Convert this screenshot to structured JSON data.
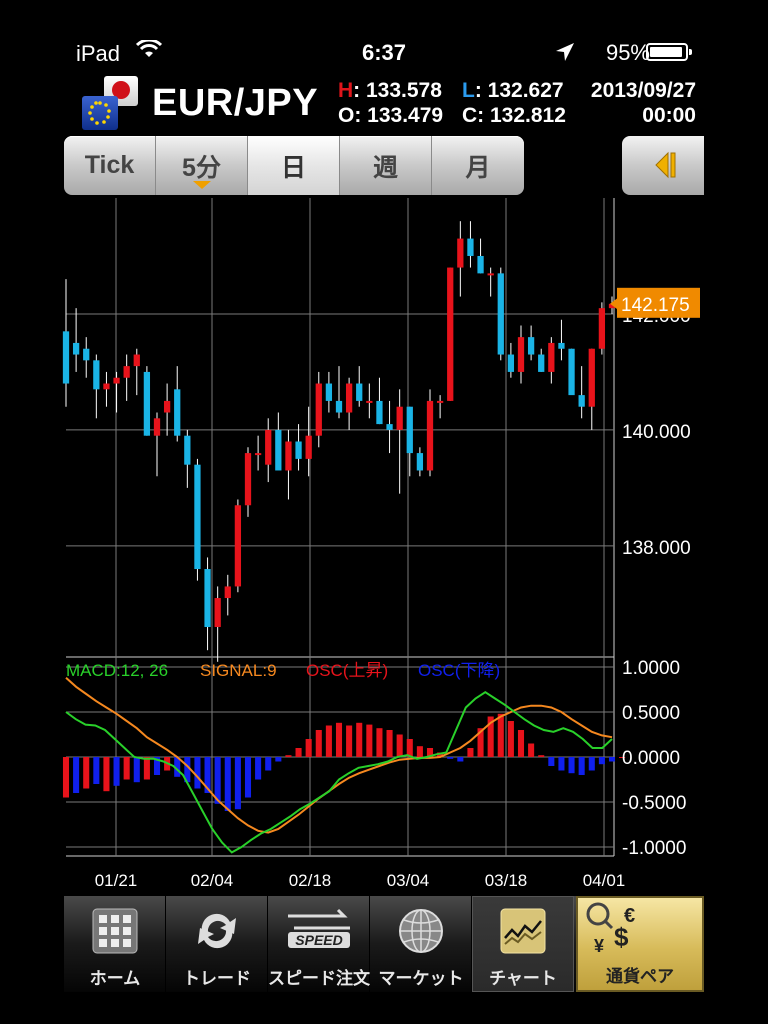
{
  "status_bar": {
    "carrier": "iPad",
    "time": "6:37",
    "battery": "95%"
  },
  "header": {
    "pair": "EUR/JPY",
    "quote": {
      "h_key": "H",
      "h": ": 133.578",
      "l_key": "L",
      "l": ": 132.627",
      "o_key": "O",
      "o": ": 133.479",
      "c_key": "C",
      "c": ": 132.812",
      "date": "2013/09/27",
      "time": "00:00"
    },
    "colors": {
      "high": "#e0151b",
      "low": "#2b9bef"
    }
  },
  "timeframes": [
    {
      "label": "Tick",
      "active": false
    },
    {
      "label": "5分",
      "active": false,
      "dropdown": true
    },
    {
      "label": "日",
      "active": true
    },
    {
      "label": "週",
      "active": false
    },
    {
      "label": "月",
      "active": false
    }
  ],
  "side_button_icon": "collapse-arrow-icon",
  "chart_data": {
    "type": "candlestick",
    "price_axis": {
      "ticks": [
        138,
        140,
        142
      ],
      "tick_labels": [
        "138.000",
        "140.000",
        "142.000"
      ],
      "range": [
        136.1,
        144.0
      ]
    },
    "current_price": "142.175",
    "current_price_value": 142.175,
    "date_labels": [
      "01/21",
      "02/04",
      "02/18",
      "03/04",
      "03/18",
      "04/01"
    ],
    "colors": {
      "up": "#e8131b",
      "down": "#1ab4e6",
      "macd": "#29d02a",
      "signal": "#f5881f",
      "osc_up": "#e8131b",
      "osc_down": "#1020ee",
      "price_tag": "#f08a00"
    },
    "candles": [
      [
        141.7,
        142.6,
        140.4,
        140.8
      ],
      [
        141.5,
        142.1,
        141.0,
        141.3
      ],
      [
        141.4,
        141.6,
        140.9,
        141.2
      ],
      [
        141.2,
        141.3,
        140.2,
        140.7
      ],
      [
        140.7,
        141.0,
        140.4,
        140.8
      ],
      [
        140.8,
        141.0,
        140.3,
        140.9
      ],
      [
        140.9,
        141.3,
        140.5,
        141.1
      ],
      [
        141.1,
        141.4,
        140.6,
        141.3
      ],
      [
        141.0,
        141.1,
        139.9,
        139.9
      ],
      [
        139.9,
        140.3,
        139.2,
        140.2
      ],
      [
        140.3,
        140.8,
        139.9,
        140.5
      ],
      [
        140.7,
        141.1,
        139.8,
        139.9
      ],
      [
        139.9,
        140.0,
        139.0,
        139.4
      ],
      [
        139.4,
        139.5,
        137.4,
        137.6
      ],
      [
        137.6,
        137.8,
        136.2,
        136.6
      ],
      [
        136.6,
        137.3,
        136.0,
        137.1
      ],
      [
        137.1,
        137.5,
        136.8,
        137.3
      ],
      [
        137.3,
        138.8,
        137.2,
        138.7
      ],
      [
        138.7,
        139.7,
        138.5,
        139.6
      ],
      [
        139.6,
        139.9,
        139.3,
        139.6
      ],
      [
        139.4,
        140.2,
        139.1,
        140.0
      ],
      [
        140.0,
        140.3,
        139.4,
        139.3
      ],
      [
        139.3,
        140.0,
        138.8,
        139.8
      ],
      [
        139.8,
        140.1,
        139.3,
        139.5
      ],
      [
        139.5,
        140.4,
        139.2,
        139.9
      ],
      [
        139.9,
        141.0,
        139.7,
        140.8
      ],
      [
        140.8,
        141.0,
        140.3,
        140.5
      ],
      [
        140.5,
        141.1,
        140.2,
        140.3
      ],
      [
        140.3,
        140.9,
        140.0,
        140.8
      ],
      [
        140.8,
        141.1,
        140.4,
        140.5
      ],
      [
        140.5,
        140.8,
        140.2,
        140.5
      ],
      [
        140.5,
        140.9,
        140.1,
        140.1
      ],
      [
        140.1,
        140.5,
        139.6,
        140.0
      ],
      [
        140.0,
        140.7,
        138.9,
        140.4
      ],
      [
        140.4,
        140.4,
        139.2,
        139.6
      ],
      [
        139.6,
        139.7,
        139.2,
        139.3
      ],
      [
        139.3,
        140.7,
        139.2,
        140.5
      ],
      [
        140.5,
        140.6,
        140.2,
        140.5
      ],
      [
        140.5,
        142.8,
        140.5,
        142.8
      ],
      [
        142.8,
        143.6,
        142.3,
        143.3
      ],
      [
        143.3,
        143.6,
        142.8,
        143.0
      ],
      [
        143.0,
        143.3,
        142.7,
        142.7
      ],
      [
        142.7,
        142.8,
        142.3,
        142.7
      ],
      [
        142.7,
        142.8,
        141.2,
        141.3
      ],
      [
        141.3,
        141.5,
        140.9,
        141.0
      ],
      [
        141.0,
        141.8,
        140.8,
        141.6
      ],
      [
        141.6,
        141.8,
        141.2,
        141.3
      ],
      [
        141.3,
        141.4,
        141.0,
        141.0
      ],
      [
        141.0,
        141.6,
        140.8,
        141.5
      ],
      [
        141.5,
        141.9,
        141.2,
        141.4
      ],
      [
        141.4,
        141.4,
        140.9,
        140.6
      ],
      [
        140.6,
        141.1,
        140.2,
        140.4
      ],
      [
        140.4,
        141.4,
        140.0,
        141.4
      ],
      [
        141.4,
        142.2,
        141.3,
        142.1
      ],
      [
        142.1,
        142.3,
        142.0,
        142.175
      ]
    ],
    "macd_panel": {
      "legend": [
        {
          "label": "MACD:12, 26",
          "color": "#29d02a"
        },
        {
          "label": "SIGNAL:9",
          "color": "#f5881f"
        },
        {
          "label": "OSC(上昇)",
          "color": "#e8131b"
        },
        {
          "label": "OSC(下降)",
          "color": "#1020ee"
        }
      ],
      "ticks": [
        1.0,
        0.5,
        0.0,
        -0.5,
        -1.0
      ],
      "tick_labels": [
        "1.0000",
        "0.5000",
        "0.0000",
        "-0.5000",
        "-1.0000"
      ],
      "range": [
        -1.1,
        1.1
      ],
      "macd": [
        0.5,
        0.42,
        0.36,
        0.35,
        0.3,
        0.2,
        0.1,
        0.0,
        -0.02,
        -0.02,
        -0.05,
        -0.1,
        -0.2,
        -0.4,
        -0.6,
        -0.8,
        -0.95,
        -1.06,
        -1.0,
        -0.92,
        -0.85,
        -0.8,
        -0.73,
        -0.66,
        -0.58,
        -0.52,
        -0.45,
        -0.38,
        -0.25,
        -0.18,
        -0.12,
        -0.1,
        -0.08,
        -0.05,
        0.0,
        0.02,
        -0.02,
        0.0,
        0.03,
        0.05,
        0.3,
        0.55,
        0.65,
        0.72,
        0.65,
        0.58,
        0.5,
        0.42,
        0.35,
        0.3,
        0.28,
        0.32,
        0.28,
        0.2,
        0.1,
        0.1,
        0.2
      ],
      "signal": [
        0.88,
        0.78,
        0.7,
        0.62,
        0.55,
        0.48,
        0.4,
        0.32,
        0.22,
        0.15,
        0.08,
        0.0,
        -0.1,
        -0.22,
        -0.35,
        -0.48,
        -0.58,
        -0.68,
        -0.76,
        -0.82,
        -0.84,
        -0.8,
        -0.72,
        -0.64,
        -0.55,
        -0.46,
        -0.38,
        -0.3,
        -0.23,
        -0.18,
        -0.14,
        -0.1,
        -0.06,
        -0.03,
        -0.02,
        -0.01,
        -0.01,
        0.0,
        0.05,
        0.1,
        0.18,
        0.28,
        0.38,
        0.45,
        0.5,
        0.55,
        0.57,
        0.57,
        0.55,
        0.5,
        0.42,
        0.35,
        0.28,
        0.24,
        0.22
      ],
      "osc": [
        -0.45,
        -0.4,
        -0.35,
        -0.3,
        -0.38,
        -0.32,
        -0.25,
        -0.28,
        -0.25,
        -0.2,
        -0.15,
        -0.22,
        -0.28,
        -0.35,
        -0.4,
        -0.52,
        -0.6,
        -0.58,
        -0.45,
        -0.25,
        -0.15,
        -0.05,
        0.02,
        0.1,
        0.2,
        0.3,
        0.35,
        0.38,
        0.35,
        0.38,
        0.36,
        0.32,
        0.3,
        0.25,
        0.2,
        0.12,
        0.1,
        0.05,
        -0.02,
        -0.05,
        0.1,
        0.32,
        0.45,
        0.48,
        0.4,
        0.3,
        0.15,
        0.02,
        -0.1,
        -0.15,
        -0.18,
        -0.2,
        -0.15,
        -0.08,
        -0.05,
        0.0
      ]
    }
  },
  "tab_bar": [
    {
      "label": "ホーム",
      "icon": "home-grid-icon",
      "active": false
    },
    {
      "label": "トレード",
      "icon": "trade-arrows-icon",
      "active": false
    },
    {
      "label": "スピード注文",
      "icon": "speed-order-icon",
      "active": false,
      "badge": "SPEED"
    },
    {
      "label": "マーケット",
      "icon": "market-globe-icon",
      "active": false
    },
    {
      "label": "チャート",
      "icon": "chart-icon",
      "active": true
    }
  ],
  "currency_button": {
    "label": "通貨ペア",
    "icon": "currency-pair-icon",
    "symbols": [
      "€",
      "$",
      "¥"
    ]
  }
}
